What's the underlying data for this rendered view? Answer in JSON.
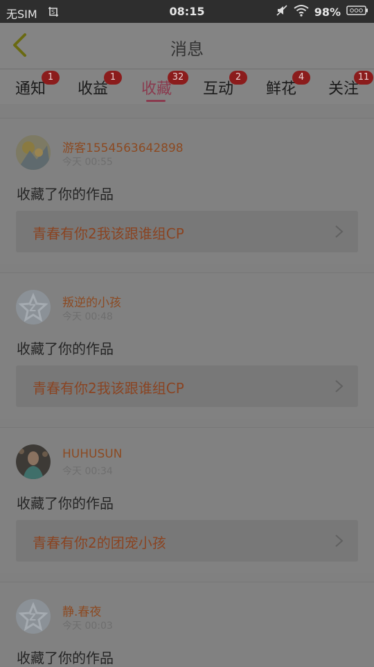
{
  "status": {
    "carrier": "无SIM",
    "time": "08:15",
    "battery": "98%"
  },
  "header": {
    "title": "消息"
  },
  "tabs": [
    {
      "label": "通知",
      "badge": "1"
    },
    {
      "label": "收益",
      "badge": "1"
    },
    {
      "label": "收藏",
      "badge": "32"
    },
    {
      "label": "互动",
      "badge": "2"
    },
    {
      "label": "鲜花",
      "badge": "4"
    },
    {
      "label": "关注",
      "badge": "11"
    }
  ],
  "items": [
    {
      "user": "游客1554563642898",
      "time": "今天 00:55",
      "action": "收藏了你的作品",
      "work": "青春有你2我该跟谁组CP",
      "avatar": "illustration-avatar"
    },
    {
      "user": "叛逆的小孩",
      "time": "今天 00:48",
      "action": "收藏了你的作品",
      "work": "青春有你2我该跟谁组CP",
      "avatar": "default-avatar"
    },
    {
      "user": "HUHUSUN",
      "time": "今天 00:34",
      "action": "收藏了你的作品",
      "work": "青春有你2的团宠小孩",
      "avatar": "photo-avatar"
    },
    {
      "user": "静.春夜",
      "time": "今天 00:03",
      "action": "收藏了你的作品",
      "work": "",
      "avatar": "default-avatar"
    }
  ],
  "colors": {
    "accent": "#8a3a4e",
    "badge": "#8b1c1c",
    "username": "#8c4a22"
  }
}
